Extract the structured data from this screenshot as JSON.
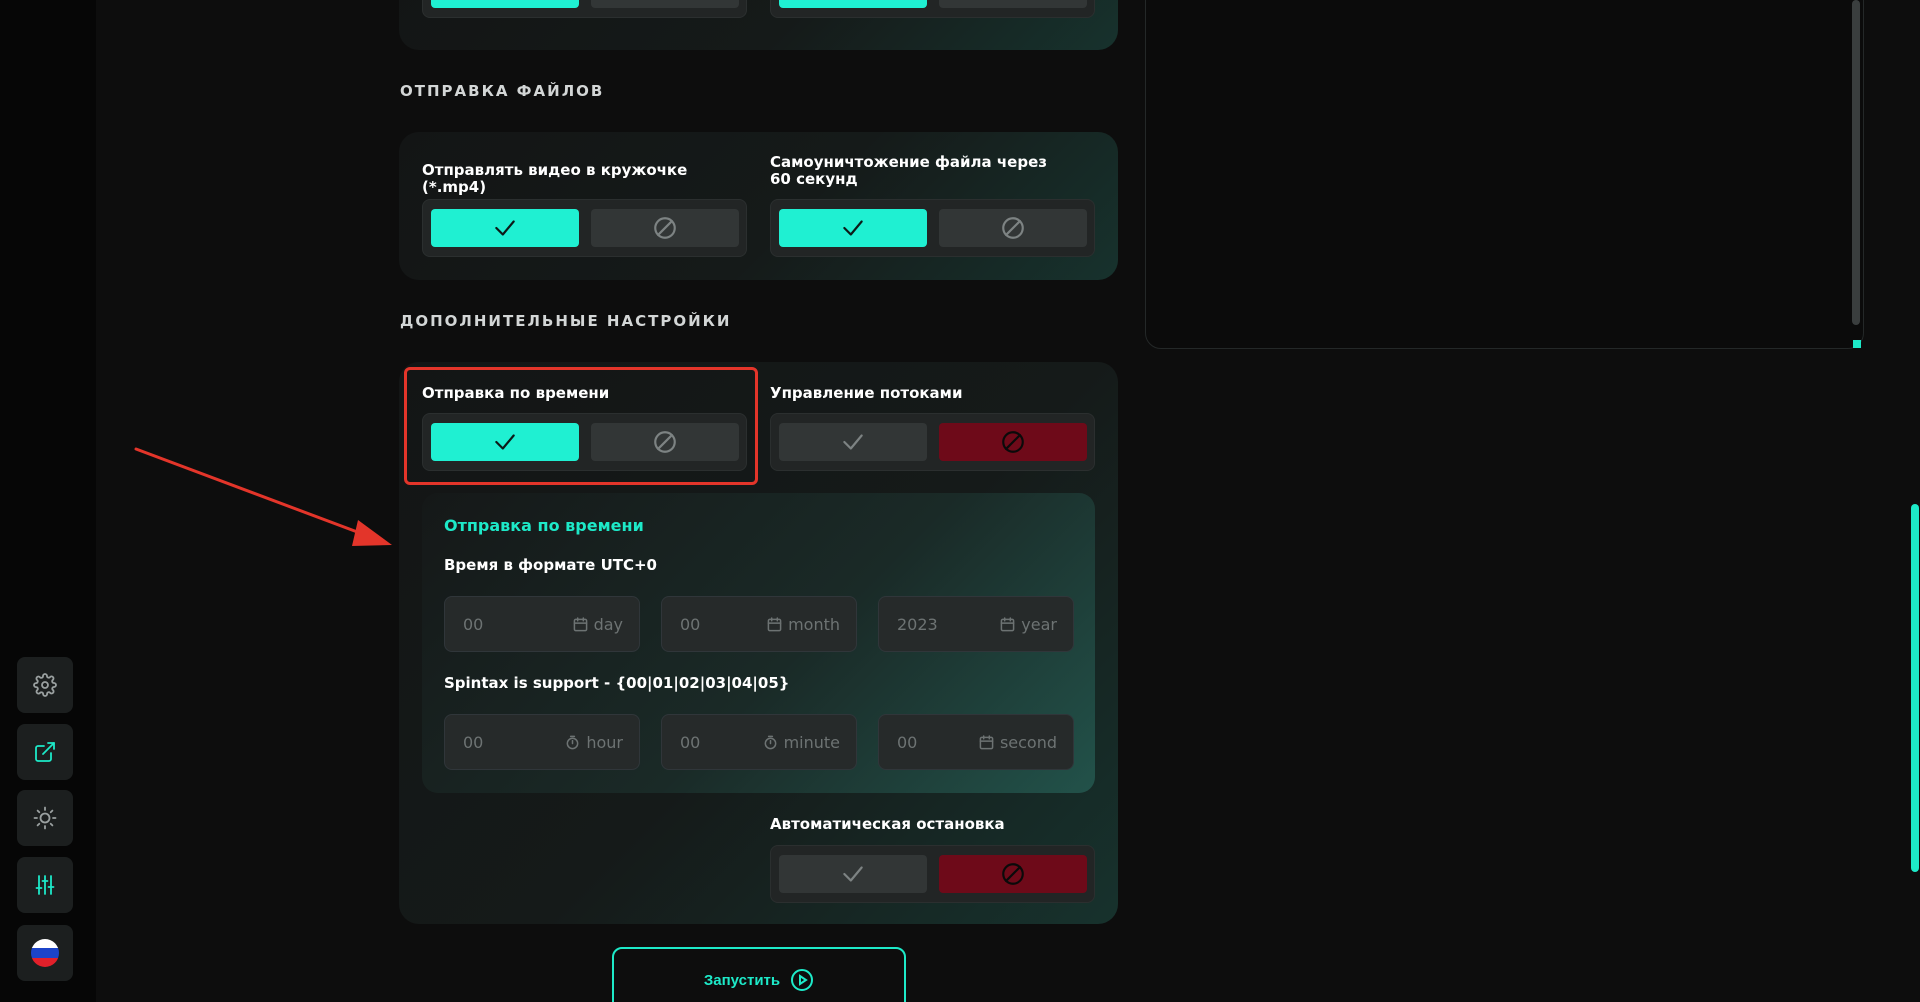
{
  "sidebar": {
    "items": [
      {
        "icon": "gear-icon"
      },
      {
        "icon": "external-link-icon"
      },
      {
        "icon": "sun-icon"
      },
      {
        "icon": "sliders-icon"
      },
      {
        "icon": "russia-flag-icon"
      }
    ]
  },
  "sections": {
    "files": {
      "title": "ОТПРАВКА ФАЙЛОВ",
      "options": [
        {
          "label": "Отправлять видео в кружочке (*.mp4)",
          "state": "on"
        },
        {
          "label": "Самоуничтожение файла через 60 секунд",
          "state": "on"
        }
      ]
    },
    "extra": {
      "title": "ДОПОЛНИТЕЛЬНЫЕ НАСТРОЙКИ",
      "options": [
        {
          "label": "Отправка по времени",
          "state": "on"
        },
        {
          "label": "Управление потоками",
          "state": "off"
        },
        {
          "label": "Автоматическая остановка",
          "state": "off"
        }
      ]
    }
  },
  "time_panel": {
    "title": "Отправка по времени",
    "date_label": "Время в формате UTC+0",
    "spintax_label": "Spintax is support - {00|01|02|03|04|05}",
    "date_fields": [
      {
        "placeholder": "00",
        "unit": "day",
        "icon": "calendar-icon"
      },
      {
        "placeholder": "00",
        "unit": "month",
        "icon": "calendar-icon"
      },
      {
        "placeholder": "2023",
        "unit": "year",
        "icon": "calendar-icon"
      }
    ],
    "time_fields": [
      {
        "placeholder": "00",
        "unit": "hour",
        "icon": "stopwatch-icon"
      },
      {
        "placeholder": "00",
        "unit": "minute",
        "icon": "stopwatch-icon"
      },
      {
        "placeholder": "00",
        "unit": "second",
        "icon": "calendar-icon"
      }
    ]
  },
  "start_button": {
    "label": "Запустить",
    "icon": "play-circle-icon"
  },
  "colors": {
    "accent": "#1ff0d2",
    "danger": "#6e0a19",
    "highlight": "#e3352a"
  }
}
